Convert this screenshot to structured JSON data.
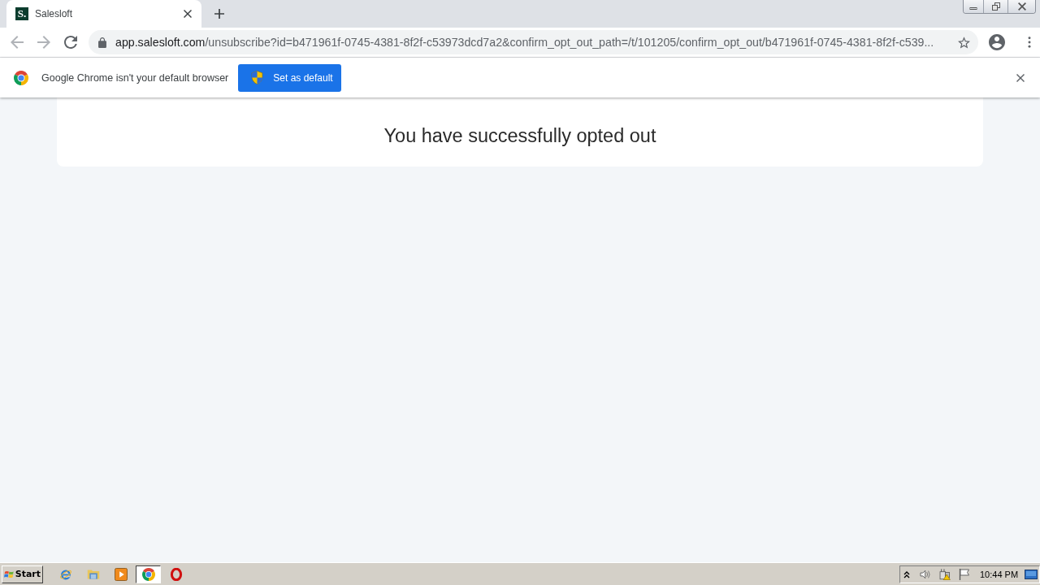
{
  "browser": {
    "tabs": [
      {
        "icon_text": "S.",
        "title": "Salesloft",
        "selected": true
      }
    ],
    "nav_buttons": [
      {
        "kind": "back",
        "disabled": true
      },
      {
        "kind": "forward",
        "disabled": true
      },
      {
        "kind": "reload",
        "disabled": false
      }
    ],
    "address_bar": {
      "host": "app.salesloft.com",
      "path": "/unsubscribe?id=b471961f-0745-4381-8f2f-c53973dcd7a2&confirm_opt_out_path=/t/101205/confirm_opt_out/b471961f-0745-4381-8f2f-c539..."
    },
    "infobar": {
      "message": "Google Chrome isn't your default browser",
      "button": "Set as default"
    }
  },
  "page": {
    "message": "You have successfully opted out"
  },
  "taskbar": {
    "start": "Start",
    "apps": [
      {
        "kind": "ie",
        "selected": false
      },
      {
        "kind": "folder",
        "selected": false
      },
      {
        "kind": "media",
        "selected": false
      },
      {
        "kind": "chrome",
        "selected": true
      },
      {
        "kind": "opera",
        "selected": false
      }
    ],
    "clock": "10:44 PM"
  }
}
